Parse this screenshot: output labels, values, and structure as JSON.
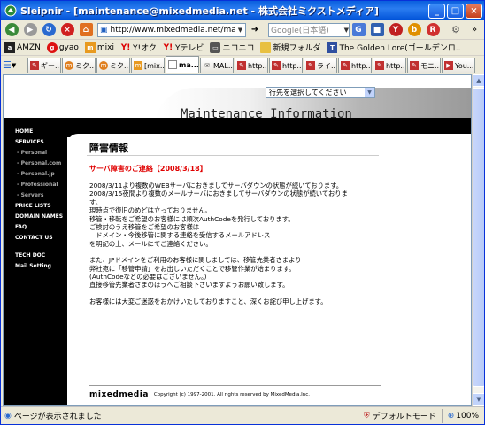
{
  "window": {
    "title": "Sleipnir - [maintenance@mixedmedia.net - 株式会社ミクストメディア]"
  },
  "toolbar": {
    "address": "http://www.mixedmedia.net/mainteh",
    "search_placeholder": "Google(日本語)"
  },
  "bookmarks": [
    {
      "label": "AMZN",
      "icon": "amazon-icon",
      "color": "#222"
    },
    {
      "label": "gyao",
      "icon": "gyao-icon",
      "color": "#d11"
    },
    {
      "label": "mixi",
      "icon": "mixi-icon",
      "color": "#e89a20"
    },
    {
      "label": "Y!オク",
      "icon": "yahoo-auction-icon",
      "color": "#d00"
    },
    {
      "label": "Yテレビ",
      "icon": "yahoo-tv-icon",
      "color": "#d00"
    },
    {
      "label": "ニコニコ",
      "icon": "nicovideo-icon",
      "color": "#555"
    },
    {
      "label": "新規フォルダ",
      "icon": "folder-icon",
      "color": "#e8c040"
    },
    {
      "label": "The Golden Lore(ゴールデンロ..",
      "icon": "page-icon",
      "color": "#3050a0"
    }
  ],
  "tabs": [
    {
      "label": "ギー..."
    },
    {
      "label": "ミク..."
    },
    {
      "label": "ミク..."
    },
    {
      "label": "[mix..."
    },
    {
      "label": "ma..."
    },
    {
      "label": "MAL..."
    },
    {
      "label": "http..."
    },
    {
      "label": "http..."
    },
    {
      "label": "ライ..."
    },
    {
      "label": "http..."
    },
    {
      "label": "http..."
    },
    {
      "label": "モニ..."
    },
    {
      "label": "You..."
    }
  ],
  "page": {
    "select_placeholder": "行先を選択してください",
    "banner_title": "Maintenance Information",
    "nav": {
      "home": "HOME",
      "services": "SERVICES",
      "personal": "- Personal",
      "personal_com": "- Personal.com",
      "personal_jp": "- Personal.jp",
      "professional": "- Professional",
      "servers": "- Servers",
      "price_lists": "PRICE LISTS",
      "domain_names": "DOMAIN NAMES",
      "faq": "FAQ",
      "contact_us": "CONTACT US",
      "tech_doc": "TECH DOC",
      "mail_setting": "Mail Setting"
    },
    "heading": "障害情報",
    "notice": "サーバ障害のご連絡【2008/3/18】",
    "paragraphs": [
      "2008/3/11より複数のWEBサーバにおきましてサーバダウンの状態が続いております。\n2008/3/15夜間より複数のメールサーバにおきましてサーバダウンの状態が続いておりま\nす。\n現時点で復旧のめどは立っておりません。\n移管・移転をご希望のお客様には順次AuthCodeを発行しております。\nご検討のうえ移管をご希望のお客様は\n　ドメイン・今後移管に関する連絡を受信するメールアドレス\nを明記の上、メールにてご連絡ください。",
      "また、JPドメインをご利用のお客様に関しましては、移管先業者さまより\n弊社宛に「移管申請」をお出しいただくことで移管作業が始まります。\n(AuthCodeなどの必要はございません。)\n直接移管先業者さまのほうへご相談下さいますようお願い致します。",
      "お客様には大変ご迷惑をおかけいたしておりますこと、深くお詫び申し上げます。"
    ],
    "footer_logo": "mixedmedia",
    "footer_copy": "Copyright (c) 1997-2001.  All rights reserved by MixedMedia.Inc."
  },
  "status": {
    "message": "ページが表示されました",
    "mode": "デフォルトモード",
    "zoom": "100%"
  }
}
